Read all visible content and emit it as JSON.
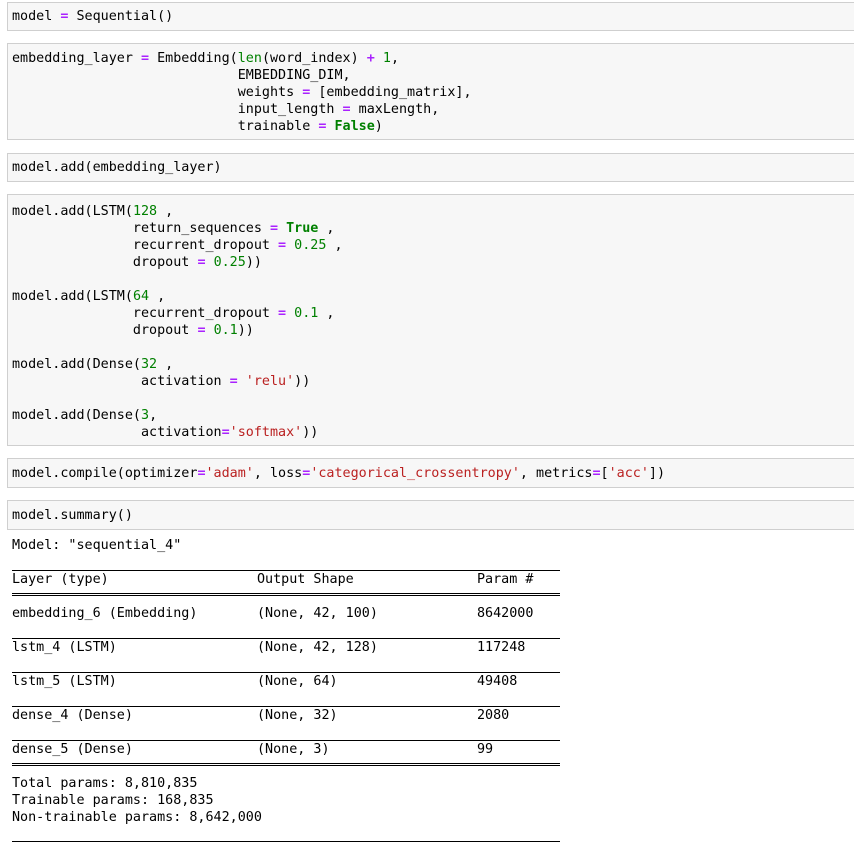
{
  "cells": {
    "c1": {
      "t": [
        "model ",
        "= ",
        "Sequential()"
      ]
    },
    "c2": {
      "l1": [
        "embedding_layer ",
        "= ",
        "Embedding(",
        "len",
        "(word_index) ",
        "+ ",
        "1",
        ","
      ],
      "l2": [
        "                            EMBEDDING_DIM,"
      ],
      "l3": [
        "                            weights ",
        "= ",
        "[embedding_matrix],"
      ],
      "l4": [
        "                            input_length ",
        "= ",
        "maxLength,"
      ],
      "l5": [
        "                            trainable ",
        "= ",
        "False",
        ")"
      ]
    },
    "c3": {
      "t": [
        "model.add(embedding_layer)"
      ]
    },
    "c4": {
      "l1": [
        "model.add(LSTM(",
        "128",
        " ,"
      ],
      "l2": [
        "               return_sequences ",
        "= ",
        "True",
        " ,"
      ],
      "l3": [
        "               recurrent_dropout ",
        "= ",
        "0.25",
        " ,"
      ],
      "l4": [
        "               dropout ",
        "= ",
        "0.25",
        "))"
      ],
      "l6": [
        "model.add(LSTM(",
        "64",
        " ,"
      ],
      "l7": [
        "               recurrent_dropout ",
        "= ",
        "0.1",
        " ,"
      ],
      "l8": [
        "               dropout ",
        "= ",
        "0.1",
        "))"
      ],
      "l10": [
        "model.add(Dense(",
        "32",
        " ,"
      ],
      "l11": [
        "                activation ",
        "= ",
        "'relu'",
        "))"
      ],
      "l13": [
        "model.add(Dense(",
        "3",
        ","
      ],
      "l14": [
        "                activation",
        "=",
        "'softmax'",
        "))"
      ]
    },
    "c5": {
      "t": [
        "model.compile(optimizer",
        "=",
        "'adam'",
        ", loss",
        "=",
        "'categorical_crossentropy'",
        ", metrics",
        "=",
        "[",
        "'acc'",
        "])"
      ]
    },
    "c6": {
      "t": [
        "model.summary()"
      ]
    }
  },
  "summary": {
    "model_line": "Model: \"sequential_4\"",
    "headers": {
      "layer": "Layer (type)",
      "shape": "Output Shape",
      "params": "Param #"
    },
    "rows": [
      {
        "layer": "embedding_6 (Embedding)",
        "shape": "(None, 42, 100)",
        "params": "8642000"
      },
      {
        "layer": "lstm_4 (LSTM)",
        "shape": "(None, 42, 128)",
        "params": "117248"
      },
      {
        "layer": "lstm_5 (LSTM)",
        "shape": "(None, 64)",
        "params": "49408"
      },
      {
        "layer": "dense_4 (Dense)",
        "shape": "(None, 32)",
        "params": "2080"
      },
      {
        "layer": "dense_5 (Dense)",
        "shape": "(None, 3)",
        "params": "99"
      }
    ],
    "total": "Total params: 8,810,835",
    "trainable": "Trainable params: 168,835",
    "non_trainable": "Non-trainable params: 8,642,000"
  },
  "colors": {
    "cell_bg": "#f7f7f7",
    "cell_border": "#cfcfcf",
    "keyword": "#008000",
    "operator": "#aa22ff",
    "string": "#ba2121"
  }
}
